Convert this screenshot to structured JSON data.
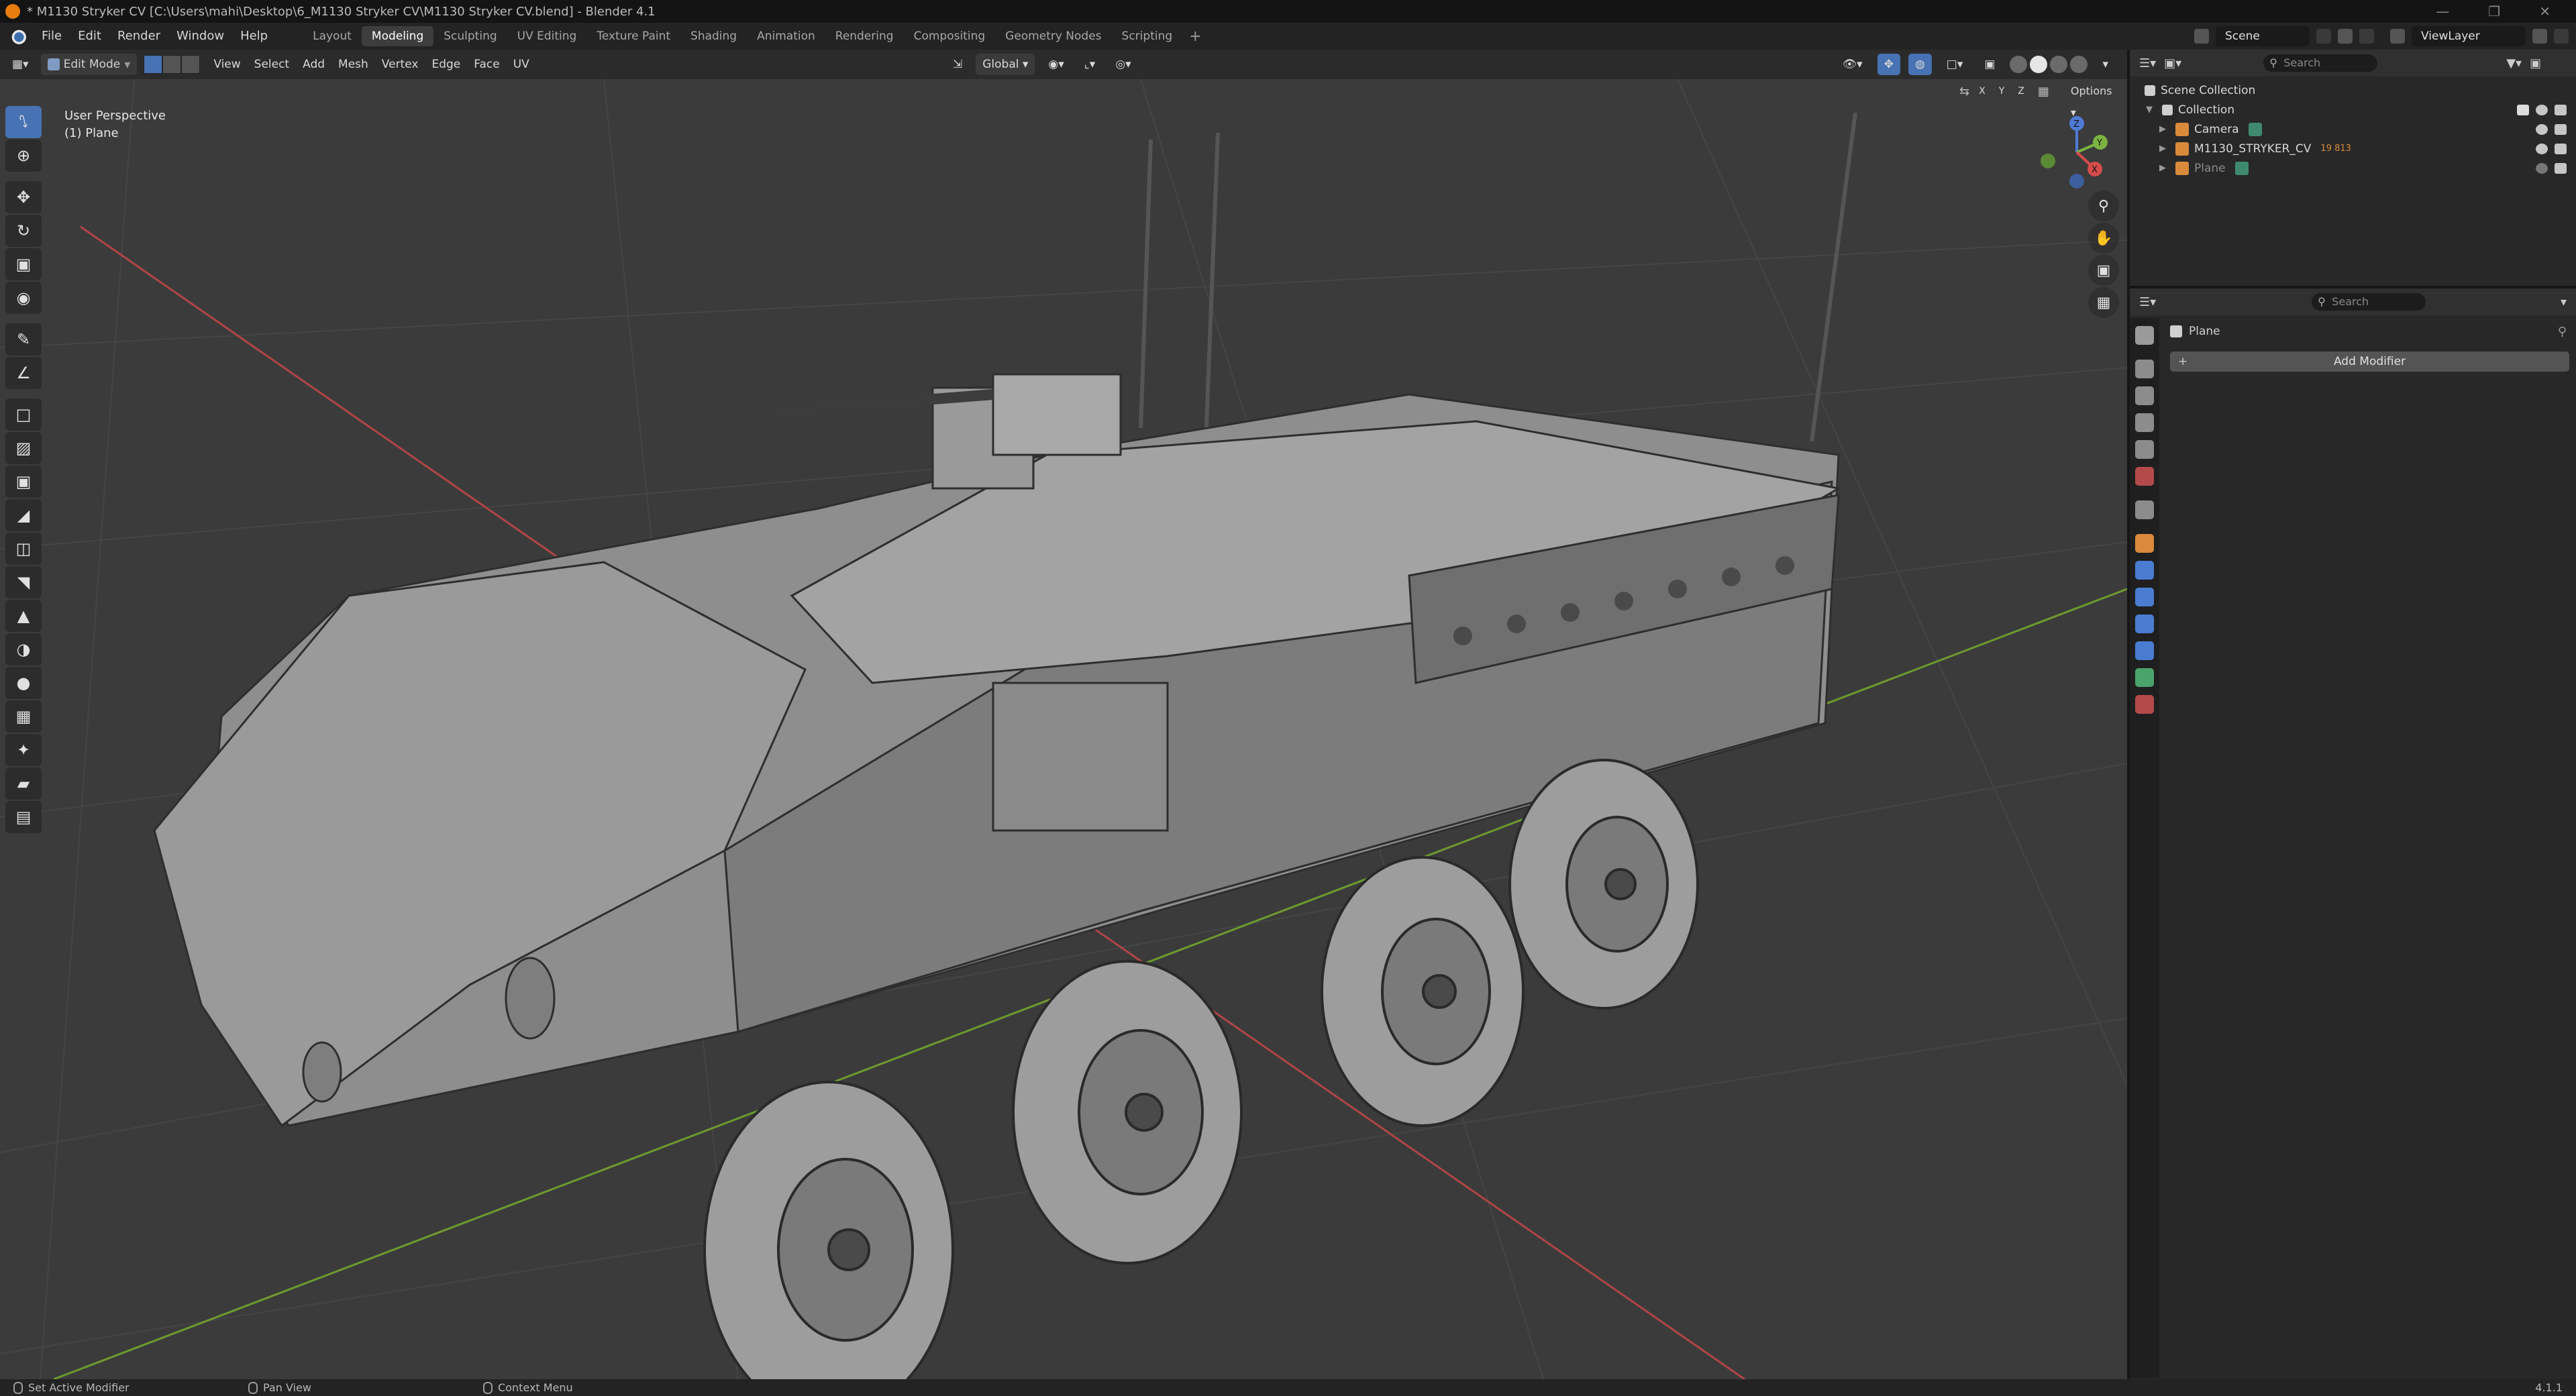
{
  "window": {
    "title": "* M1130 Stryker CV [C:\\Users\\mahi\\Desktop\\6_M1130 Stryker CV\\M1130 Stryker CV.blend] - Blender 4.1"
  },
  "menu": {
    "items": [
      "File",
      "Edit",
      "Render",
      "Window",
      "Help"
    ]
  },
  "workspaces": {
    "tabs": [
      "Layout",
      "Modeling",
      "Sculpting",
      "UV Editing",
      "Texture Paint",
      "Shading",
      "Animation",
      "Rendering",
      "Compositing",
      "Geometry Nodes",
      "Scripting"
    ],
    "active": "Modeling"
  },
  "scene": {
    "name": "Scene",
    "view_layer": "ViewLayer"
  },
  "viewport_header": {
    "mode": "Edit Mode",
    "menus": [
      "View",
      "Select",
      "Add",
      "Mesh",
      "Vertex",
      "Edge",
      "Face",
      "UV"
    ],
    "orientation": "Global",
    "options_label": "Options",
    "axes": [
      "X",
      "Y",
      "Z"
    ]
  },
  "viewport": {
    "perspective": "User Perspective",
    "active_object": "(1) Plane",
    "gizmo": {
      "x": "X",
      "y": "Y",
      "z": "Z"
    }
  },
  "outliner": {
    "search_placeholder": "Search",
    "root": "Scene Collection",
    "collection": "Collection",
    "items": [
      {
        "name": "Camera"
      },
      {
        "name": "M1130_STRYKER_CV",
        "badge": "19 813"
      },
      {
        "name": "Plane"
      }
    ]
  },
  "properties": {
    "search_placeholder": "Search",
    "object_name": "Plane",
    "add_modifier": "Add Modifier"
  },
  "statusbar": {
    "left": "Set Active Modifier",
    "middle": "Pan View",
    "right": "Context Menu",
    "version": "4.1.1"
  },
  "colors": {
    "accent": "#4772b3",
    "grid_x": "#c24848",
    "grid_y": "#6d9b2e",
    "viewport_bg": "#3b3b3b"
  }
}
